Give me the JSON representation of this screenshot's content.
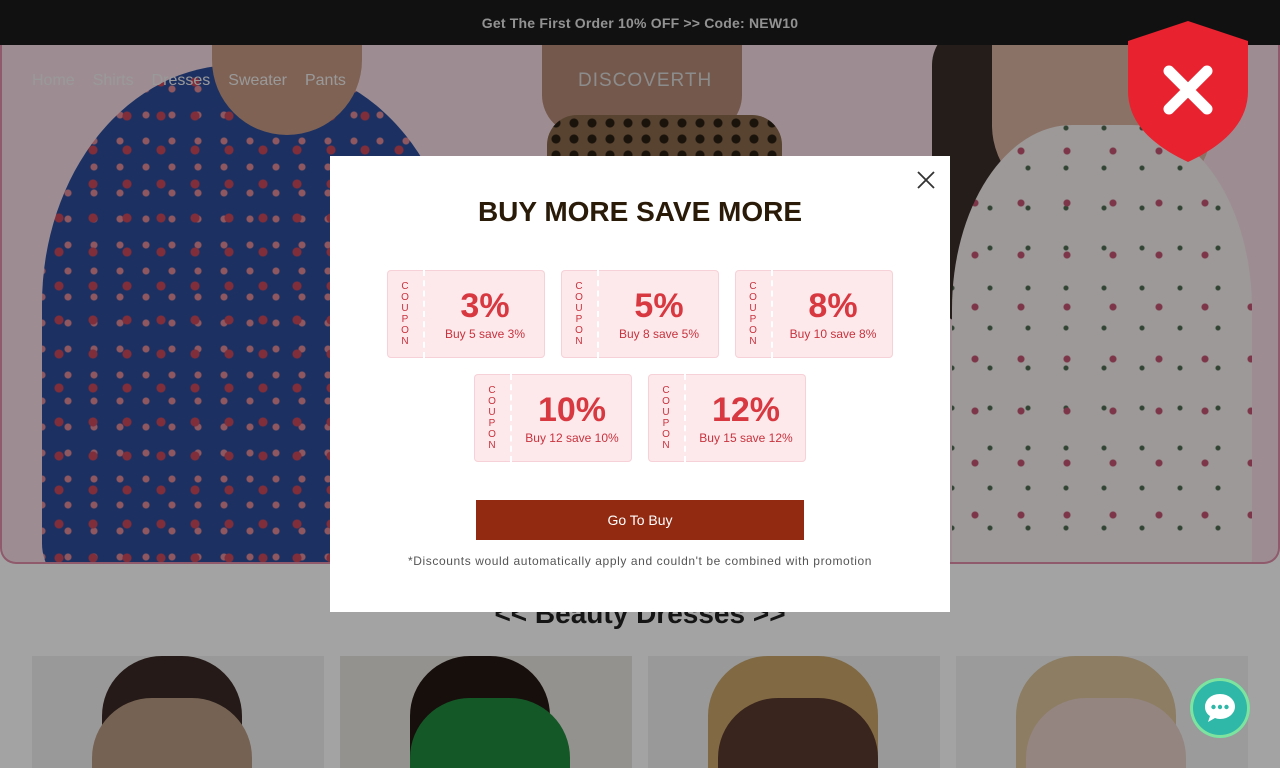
{
  "announcement": "Get The First Order 10% OFF >> Code: NEW10",
  "nav": {
    "items": [
      {
        "label": "Home"
      },
      {
        "label": "Shirts"
      },
      {
        "label": "Dresses"
      },
      {
        "label": "Sweater"
      },
      {
        "label": "Pants"
      }
    ]
  },
  "brand": {
    "logo": "DISCOVERTH"
  },
  "section": {
    "title": "<< Beauty Dresses >>"
  },
  "popup": {
    "title": "BUY MORE SAVE MORE",
    "coupon_stub_letters": [
      "C",
      "O",
      "U",
      "P",
      "O",
      "N"
    ],
    "coupons": [
      {
        "percent": "3%",
        "desc": "Buy 5 save 3%"
      },
      {
        "percent": "5%",
        "desc": "Buy 8 save 5%"
      },
      {
        "percent": "8%",
        "desc": "Buy 10 save 8%"
      },
      {
        "percent": "10%",
        "desc": "Buy 12 save 10%"
      },
      {
        "percent": "12%",
        "desc": "Buy 15 save 12%"
      }
    ],
    "button_label": "Go To Buy",
    "note": "*Discounts would automatically apply and couldn't be combined with promotion"
  },
  "icons": {
    "close": "close-icon",
    "shield_block": "shield-x-icon",
    "chat": "chat-bubble-icon"
  },
  "colors": {
    "accent": "#922a12",
    "coupon_red": "#d83840",
    "shield": "#e8222e",
    "chat": "#2fb7a8"
  }
}
